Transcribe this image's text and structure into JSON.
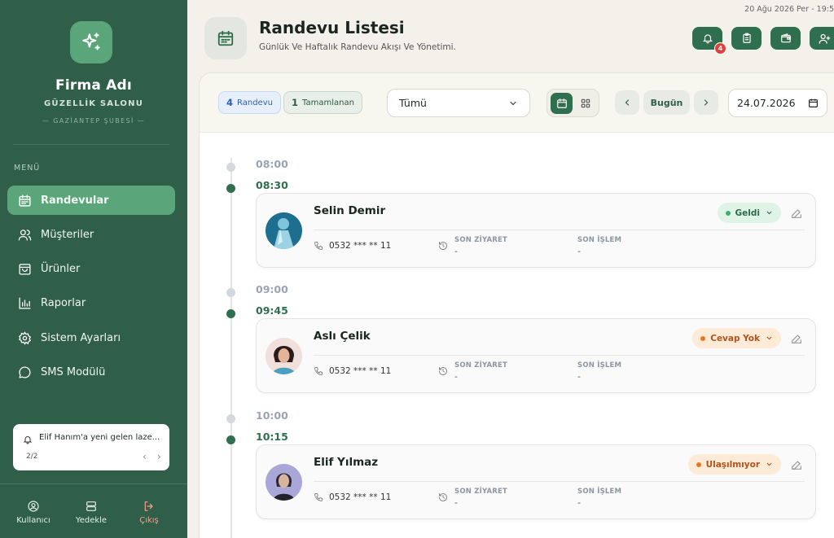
{
  "sidebar": {
    "brand_name": "Firma Adı",
    "brand_sub": "GÜZELLİK SALONU",
    "branch": "— GAZİANTEP ŞUBESİ —",
    "menu_label": "MENÜ",
    "items": [
      {
        "label": "Randevular",
        "icon": "calendar-icon",
        "active": true
      },
      {
        "label": "Müşteriler",
        "icon": "users-icon"
      },
      {
        "label": "Ürünler",
        "icon": "bag-icon"
      },
      {
        "label": "Raporlar",
        "icon": "bar-chart-icon"
      },
      {
        "label": "Sistem Ayarları",
        "icon": "gear-icon"
      },
      {
        "label": "SMS Modülü",
        "icon": "chat-icon"
      }
    ],
    "notification": {
      "text": "Elif Hanım'a yeni gelen laze...",
      "count": "2/2"
    },
    "footer": {
      "user": "Kullanıcı",
      "backup": "Yedekle",
      "logout": "Çıkış"
    }
  },
  "header": {
    "date_text": "20 Ağu 2026 Per - 19:5",
    "title": "Randevu Listesi",
    "subtitle": "Günlük Ve Haftalık Randevu Akışı Ve Yönetimi.",
    "notification_badge": "4"
  },
  "toolbar": {
    "appointments_count": "4",
    "appointments_label": "Randevu",
    "completed_count": "1",
    "completed_label": "Tamamlanan",
    "filter_value": "Tümü",
    "today_label": "Bugün",
    "date_value": "24.07.2026"
  },
  "meta_labels": {
    "last_visit": "SON ZİYARET",
    "last_service": "SON İŞLEM"
  },
  "timeline": {
    "slots": [
      "08:00",
      "08:30",
      "09:00",
      "09:45",
      "10:00",
      "10:15"
    ],
    "appointments": [
      {
        "name": "Selin Demir",
        "phone": "0532 *** ** 11",
        "last_visit": "-",
        "last_service": "-",
        "status": "Geldi",
        "status_color": "#3fae6a"
      },
      {
        "name": "Aslı Çelik",
        "phone": "0532 *** ** 11",
        "last_visit": "-",
        "last_service": "-",
        "status": "Cevap Yok",
        "status_color": "#e77628"
      },
      {
        "name": "Elif Yılmaz",
        "phone": "0532 *** ** 11",
        "last_visit": "-",
        "last_service": "-",
        "status": "Ulaşılmıyor",
        "status_color": "#e77628"
      }
    ]
  },
  "colors": {
    "sidebar_bg": "#2f5f49",
    "accent": "#2f6e4e",
    "active_item": "#5aa579"
  }
}
